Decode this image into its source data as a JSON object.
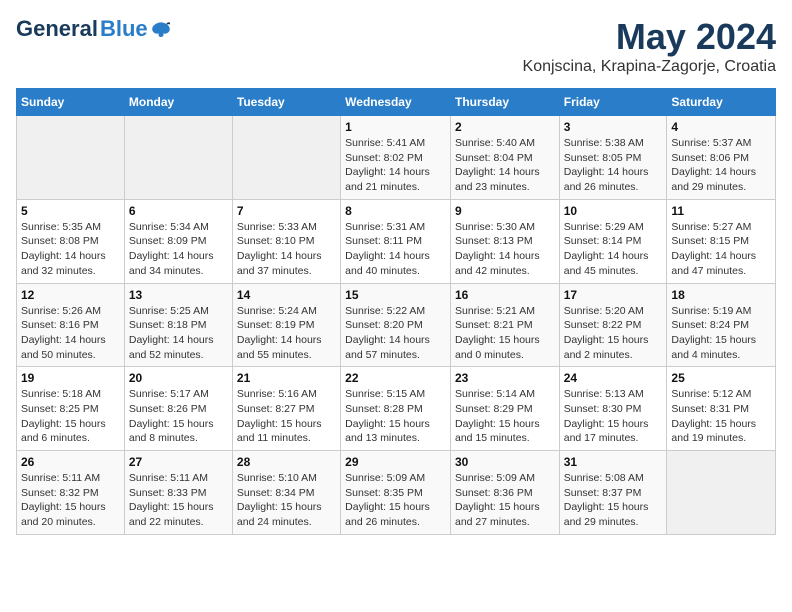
{
  "header": {
    "logo_general": "General",
    "logo_blue": "Blue",
    "month_year": "May 2024",
    "location": "Konjscina, Krapina-Zagorje, Croatia"
  },
  "days_of_week": [
    "Sunday",
    "Monday",
    "Tuesday",
    "Wednesday",
    "Thursday",
    "Friday",
    "Saturday"
  ],
  "weeks": [
    [
      {
        "num": "",
        "info": ""
      },
      {
        "num": "",
        "info": ""
      },
      {
        "num": "",
        "info": ""
      },
      {
        "num": "1",
        "info": "Sunrise: 5:41 AM\nSunset: 8:02 PM\nDaylight: 14 hours and 21 minutes."
      },
      {
        "num": "2",
        "info": "Sunrise: 5:40 AM\nSunset: 8:04 PM\nDaylight: 14 hours and 23 minutes."
      },
      {
        "num": "3",
        "info": "Sunrise: 5:38 AM\nSunset: 8:05 PM\nDaylight: 14 hours and 26 minutes."
      },
      {
        "num": "4",
        "info": "Sunrise: 5:37 AM\nSunset: 8:06 PM\nDaylight: 14 hours and 29 minutes."
      }
    ],
    [
      {
        "num": "5",
        "info": "Sunrise: 5:35 AM\nSunset: 8:08 PM\nDaylight: 14 hours and 32 minutes."
      },
      {
        "num": "6",
        "info": "Sunrise: 5:34 AM\nSunset: 8:09 PM\nDaylight: 14 hours and 34 minutes."
      },
      {
        "num": "7",
        "info": "Sunrise: 5:33 AM\nSunset: 8:10 PM\nDaylight: 14 hours and 37 minutes."
      },
      {
        "num": "8",
        "info": "Sunrise: 5:31 AM\nSunset: 8:11 PM\nDaylight: 14 hours and 40 minutes."
      },
      {
        "num": "9",
        "info": "Sunrise: 5:30 AM\nSunset: 8:13 PM\nDaylight: 14 hours and 42 minutes."
      },
      {
        "num": "10",
        "info": "Sunrise: 5:29 AM\nSunset: 8:14 PM\nDaylight: 14 hours and 45 minutes."
      },
      {
        "num": "11",
        "info": "Sunrise: 5:27 AM\nSunset: 8:15 PM\nDaylight: 14 hours and 47 minutes."
      }
    ],
    [
      {
        "num": "12",
        "info": "Sunrise: 5:26 AM\nSunset: 8:16 PM\nDaylight: 14 hours and 50 minutes."
      },
      {
        "num": "13",
        "info": "Sunrise: 5:25 AM\nSunset: 8:18 PM\nDaylight: 14 hours and 52 minutes."
      },
      {
        "num": "14",
        "info": "Sunrise: 5:24 AM\nSunset: 8:19 PM\nDaylight: 14 hours and 55 minutes."
      },
      {
        "num": "15",
        "info": "Sunrise: 5:22 AM\nSunset: 8:20 PM\nDaylight: 14 hours and 57 minutes."
      },
      {
        "num": "16",
        "info": "Sunrise: 5:21 AM\nSunset: 8:21 PM\nDaylight: 15 hours and 0 minutes."
      },
      {
        "num": "17",
        "info": "Sunrise: 5:20 AM\nSunset: 8:22 PM\nDaylight: 15 hours and 2 minutes."
      },
      {
        "num": "18",
        "info": "Sunrise: 5:19 AM\nSunset: 8:24 PM\nDaylight: 15 hours and 4 minutes."
      }
    ],
    [
      {
        "num": "19",
        "info": "Sunrise: 5:18 AM\nSunset: 8:25 PM\nDaylight: 15 hours and 6 minutes."
      },
      {
        "num": "20",
        "info": "Sunrise: 5:17 AM\nSunset: 8:26 PM\nDaylight: 15 hours and 8 minutes."
      },
      {
        "num": "21",
        "info": "Sunrise: 5:16 AM\nSunset: 8:27 PM\nDaylight: 15 hours and 11 minutes."
      },
      {
        "num": "22",
        "info": "Sunrise: 5:15 AM\nSunset: 8:28 PM\nDaylight: 15 hours and 13 minutes."
      },
      {
        "num": "23",
        "info": "Sunrise: 5:14 AM\nSunset: 8:29 PM\nDaylight: 15 hours and 15 minutes."
      },
      {
        "num": "24",
        "info": "Sunrise: 5:13 AM\nSunset: 8:30 PM\nDaylight: 15 hours and 17 minutes."
      },
      {
        "num": "25",
        "info": "Sunrise: 5:12 AM\nSunset: 8:31 PM\nDaylight: 15 hours and 19 minutes."
      }
    ],
    [
      {
        "num": "26",
        "info": "Sunrise: 5:11 AM\nSunset: 8:32 PM\nDaylight: 15 hours and 20 minutes."
      },
      {
        "num": "27",
        "info": "Sunrise: 5:11 AM\nSunset: 8:33 PM\nDaylight: 15 hours and 22 minutes."
      },
      {
        "num": "28",
        "info": "Sunrise: 5:10 AM\nSunset: 8:34 PM\nDaylight: 15 hours and 24 minutes."
      },
      {
        "num": "29",
        "info": "Sunrise: 5:09 AM\nSunset: 8:35 PM\nDaylight: 15 hours and 26 minutes."
      },
      {
        "num": "30",
        "info": "Sunrise: 5:09 AM\nSunset: 8:36 PM\nDaylight: 15 hours and 27 minutes."
      },
      {
        "num": "31",
        "info": "Sunrise: 5:08 AM\nSunset: 8:37 PM\nDaylight: 15 hours and 29 minutes."
      },
      {
        "num": "",
        "info": ""
      }
    ]
  ]
}
